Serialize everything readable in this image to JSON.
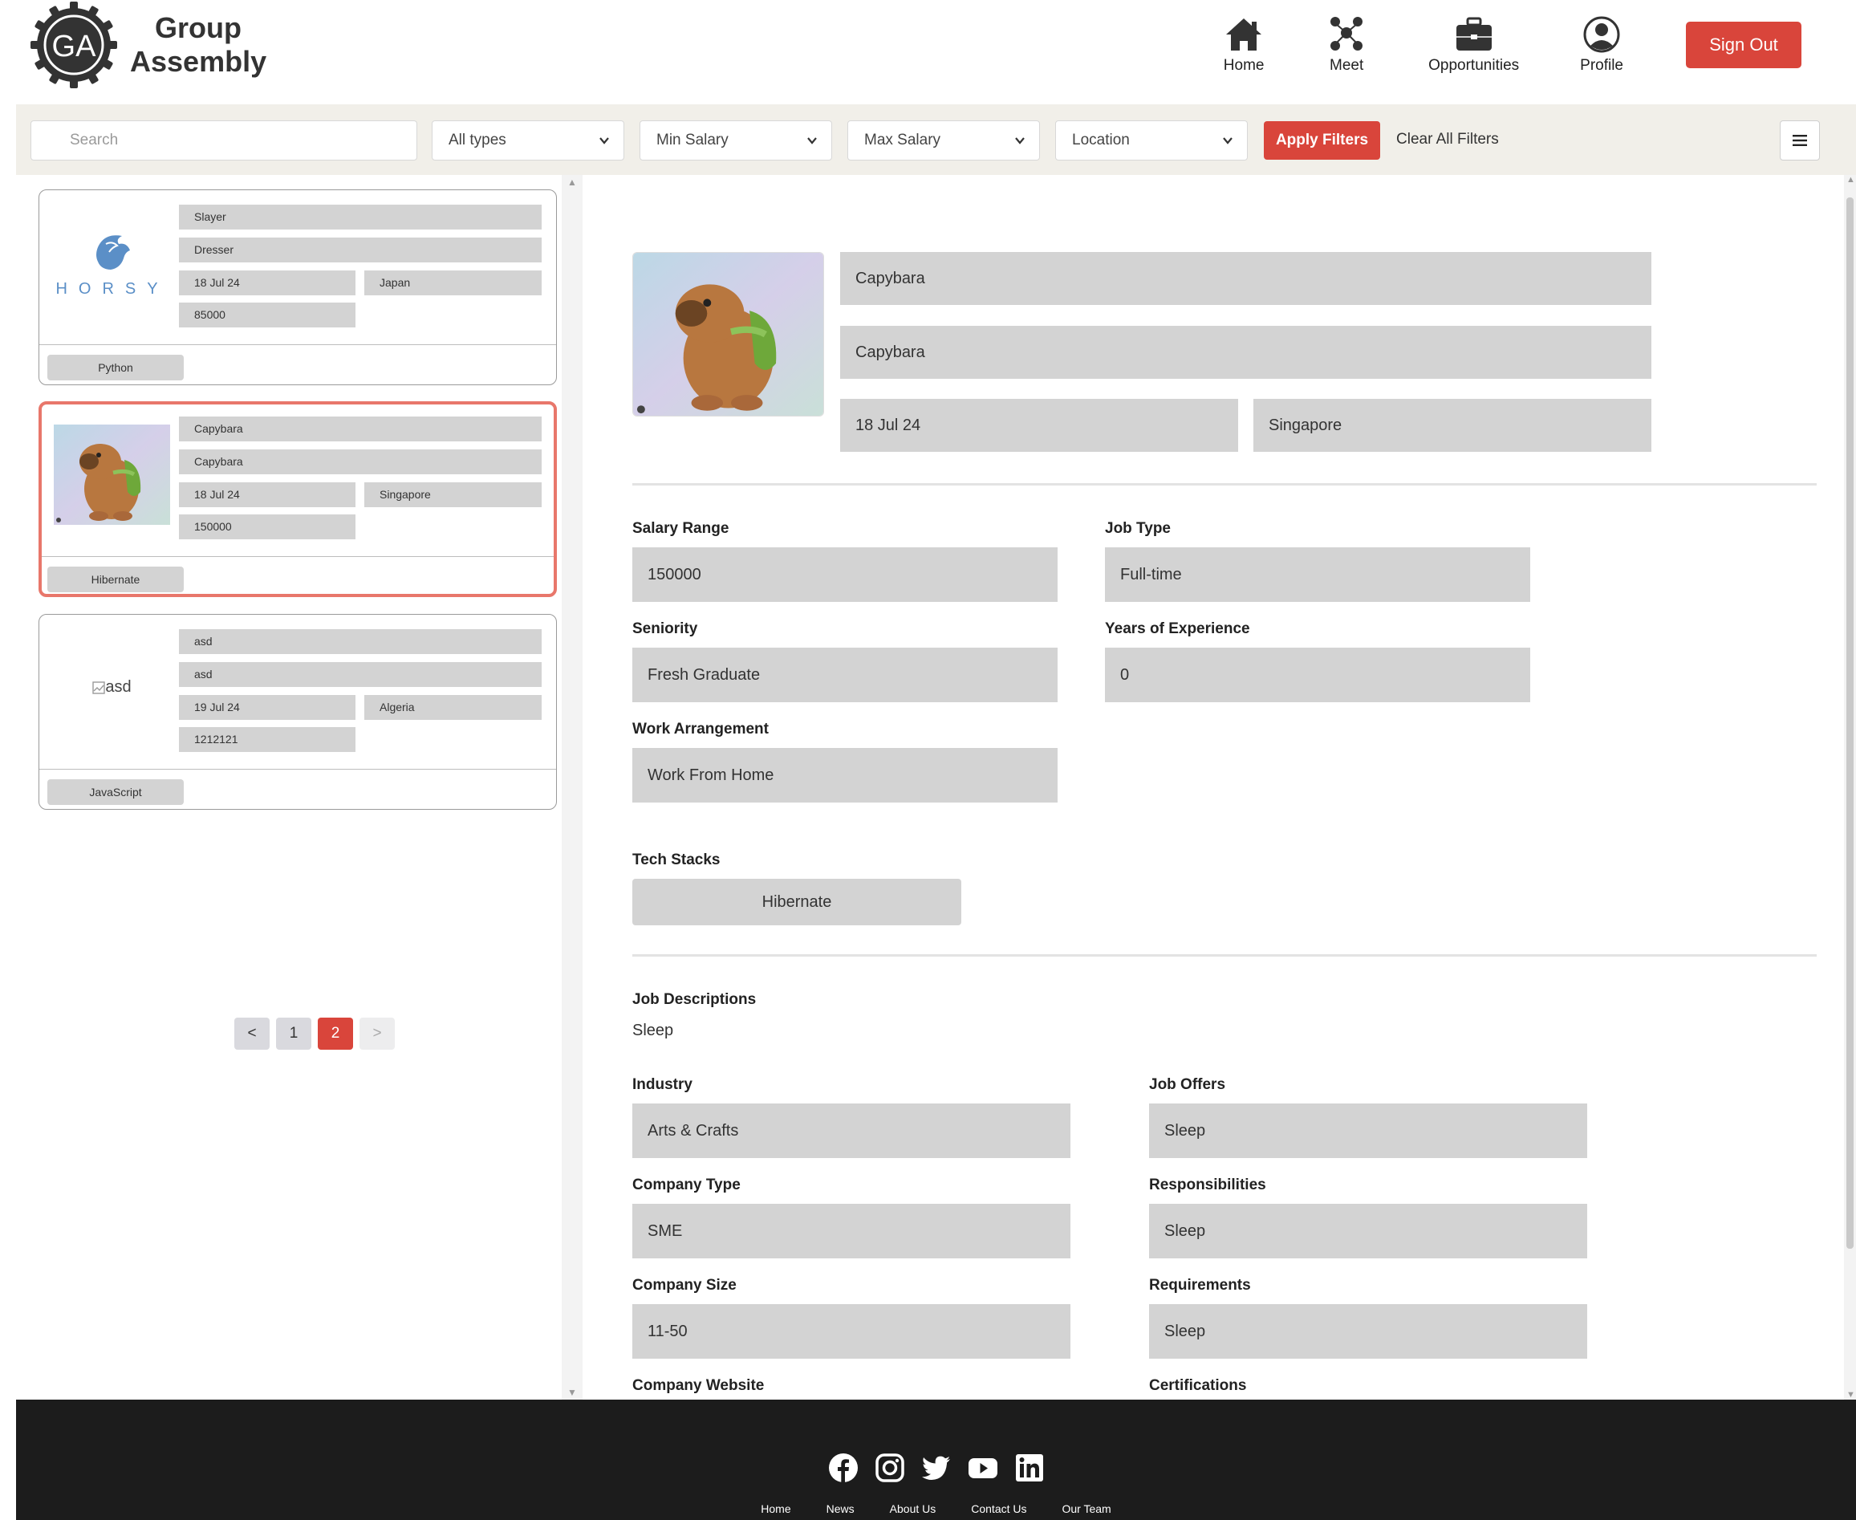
{
  "brand": {
    "logo_initials": "GA",
    "name_line1": "Group",
    "name_line2": "Assembly"
  },
  "nav": {
    "items": [
      {
        "label": "Home",
        "icon": "home-icon"
      },
      {
        "label": "Meet",
        "icon": "people-network-icon"
      },
      {
        "label": "Opportunities",
        "icon": "briefcase-icon"
      },
      {
        "label": "Profile",
        "icon": "user-circle-icon"
      }
    ],
    "signout_label": "Sign Out"
  },
  "filters": {
    "search_placeholder": "Search",
    "type": "All types",
    "min_salary": "Min Salary",
    "max_salary": "Max Salary",
    "location": "Location",
    "apply_label": "Apply Filters",
    "clear_label": "Clear All Filters"
  },
  "listings": [
    {
      "logo": "horsy-logo",
      "logo_text": "HORSY",
      "title": "Slayer",
      "company": "Dresser",
      "date": "18 Jul 24",
      "location": "Japan",
      "salary": "85000",
      "tag": "Python",
      "selected": false
    },
    {
      "logo": "capybara-image",
      "title": "Capybara",
      "company": "Capybara",
      "date": "18 Jul 24",
      "location": "Singapore",
      "salary": "150000",
      "tag": "Hibernate",
      "selected": true
    },
    {
      "logo": "broken-image",
      "logo_alt": "asd",
      "title": "asd",
      "company": "asd",
      "date": "19 Jul 24",
      "location": "Algeria",
      "salary": "1212121",
      "tag": "JavaScript",
      "selected": false
    }
  ],
  "pagination": {
    "prev": "<",
    "pages": [
      "1",
      "2"
    ],
    "current": "2",
    "next": ">"
  },
  "detail": {
    "title": "Capybara",
    "company": "Capybara",
    "date": "18 Jul 24",
    "location": "Singapore",
    "salary_range": {
      "label": "Salary Range",
      "value": "150000"
    },
    "job_type": {
      "label": "Job Type",
      "value": "Full-time"
    },
    "seniority": {
      "label": "Seniority",
      "value": "Fresh Graduate"
    },
    "experience": {
      "label": "Years of Experience",
      "value": "0"
    },
    "arrangement": {
      "label": "Work Arrangement",
      "value": "Work From Home"
    },
    "tech": {
      "label": "Tech Stacks",
      "value": "Hibernate"
    },
    "descriptions": {
      "label": "Job Descriptions",
      "value": "Sleep"
    },
    "industry": {
      "label": "Industry",
      "value": "Arts & Crafts"
    },
    "offers": {
      "label": "Job Offers",
      "value": "Sleep"
    },
    "company_type": {
      "label": "Company Type",
      "value": "SME"
    },
    "responsibilities": {
      "label": "Responsibilities",
      "value": "Sleep"
    },
    "company_size": {
      "label": "Company Size",
      "value": "11-50"
    },
    "requirements": {
      "label": "Requirements",
      "value": "Sleep"
    },
    "website": {
      "label": "Company Website"
    },
    "certifications": {
      "label": "Certifications"
    }
  },
  "footer": {
    "socials": [
      "facebook-icon",
      "instagram-icon",
      "twitter-icon",
      "youtube-icon",
      "linkedin-icon"
    ],
    "links": [
      "Home",
      "News",
      "About Us",
      "Contact Us",
      "Our Team"
    ]
  },
  "colors": {
    "accent": "#d9453b",
    "selected_border": "#e8776b",
    "field_bg": "#d3d3d3",
    "filter_bg": "#f1efe9",
    "footer_bg": "#1c1c1c"
  }
}
